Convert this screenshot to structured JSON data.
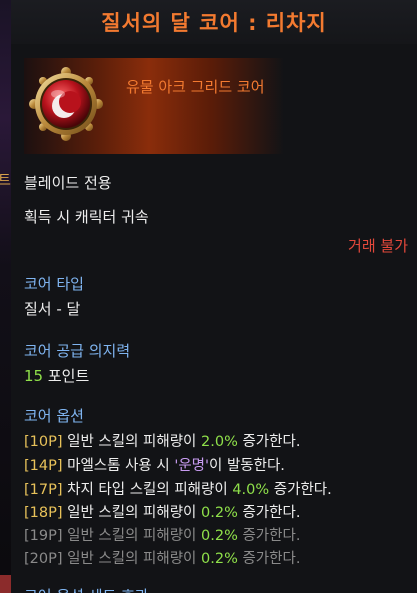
{
  "background_edge": {
    "glyph": "트"
  },
  "tooltip": {
    "title": "질서의 달 코어 : 리차지",
    "item_grade": "유물 아크 그리드 코어",
    "class_restriction": "블레이드 전용",
    "bind_info": "획득 시 캐릭터 귀속",
    "trade_status": "거래 불가",
    "core_type": {
      "label": "코어 타입",
      "value": "질서 - 달"
    },
    "willpower": {
      "label": "코어 공급 의지력",
      "amount": "15",
      "unit": " 포인트"
    },
    "options": {
      "label": "코어 옵션",
      "items": [
        {
          "level": "[10P]",
          "pre": " 일반 스킬의 피해량이 ",
          "val": "2.0%",
          "post": " 증가한다.",
          "active": true
        },
        {
          "level": "[14P]",
          "pre": " 마엘스톰 사용 시 ",
          "val": "'운명'",
          "post": "이 발동한다.",
          "active": true
        },
        {
          "level": "[17P]",
          "pre": " 차지 타입 스킬의 피해량이 ",
          "val": "4.0%",
          "post": " 증가한다.",
          "active": true
        },
        {
          "level": "[18P]",
          "pre": " 일반 스킬의 피해량이 ",
          "val": "0.2%",
          "post": " 증가한다.",
          "active": true
        },
        {
          "level": "[19P]",
          "pre": " 일반 스킬의 피해량이 ",
          "val": "0.2%",
          "post": " 증가한다.",
          "active": false
        },
        {
          "level": "[20P]",
          "pre": " 일반 스킬의 피해량이 ",
          "val": "0.2%",
          "post": " 증가한다.",
          "active": false
        }
      ]
    },
    "next_section_partial": "코어 옵션 세트 효과"
  },
  "colors": {
    "title": "#f37a30",
    "grade": "#f37a30",
    "section": "#7fb4f0",
    "value_green": "#8fe04a",
    "level_gold": "#e8c25a",
    "value_purple": "#c79bf0",
    "inactive": "#8a8a8a",
    "trade": "#e2483b"
  },
  "icons": {
    "item": "crescent-moon-core-icon"
  }
}
